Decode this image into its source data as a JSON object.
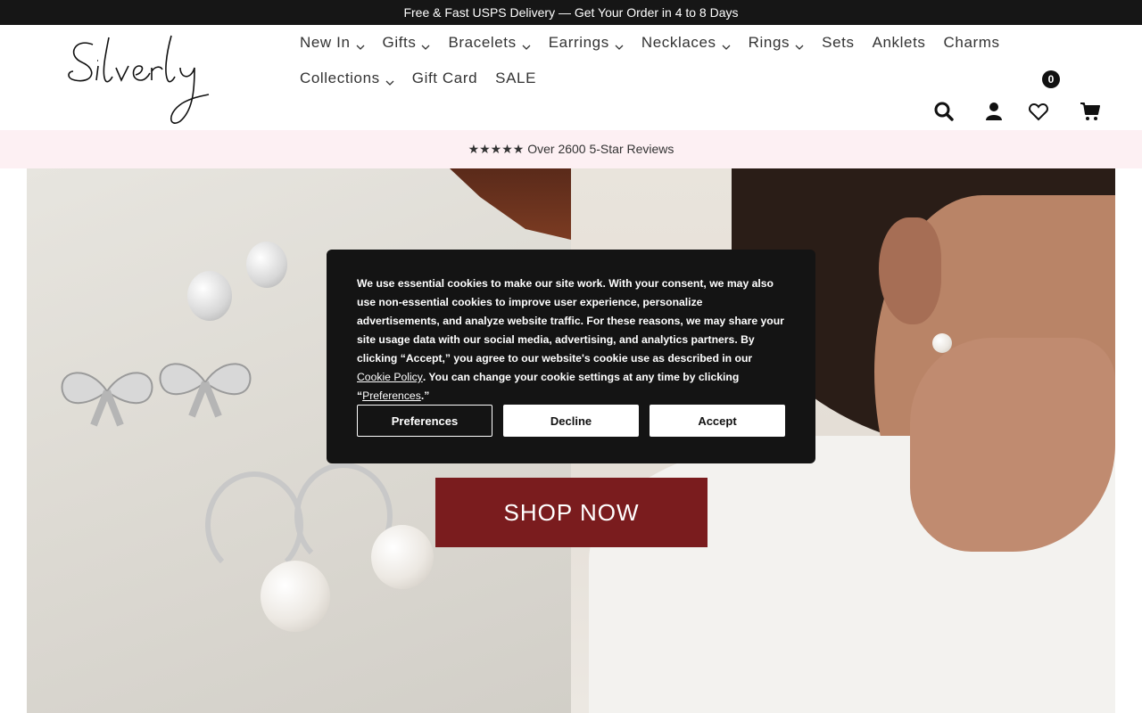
{
  "announcement": "Free & Fast USPS Delivery — Get Your Order in 4 to 8 Days",
  "logo": {
    "text": "Silverly"
  },
  "nav": {
    "row1": [
      {
        "label": "New In",
        "dropdown": true
      },
      {
        "label": "Gifts",
        "dropdown": true
      },
      {
        "label": "Bracelets",
        "dropdown": true
      },
      {
        "label": "Earrings",
        "dropdown": true
      },
      {
        "label": "Necklaces",
        "dropdown": true
      },
      {
        "label": "Rings",
        "dropdown": true
      },
      {
        "label": "Sets",
        "dropdown": false
      },
      {
        "label": "Anklets",
        "dropdown": false
      },
      {
        "label": "Charms",
        "dropdown": false
      }
    ],
    "row2": [
      {
        "label": "Collections",
        "dropdown": true
      },
      {
        "label": "Gift Card",
        "dropdown": false
      },
      {
        "label": "SALE",
        "dropdown": false
      }
    ]
  },
  "header_icons": {
    "search": "search-icon",
    "account": "user-icon",
    "wishlist": "heart-icon",
    "wishlist_count": "0",
    "cart": "cart-icon"
  },
  "reviews_bar": "★★★★★ Over 2600 5-Star Reviews",
  "hero": {
    "cta": "SHOP NOW",
    "cta_color": "#7a1c1e"
  },
  "cookie_banner": {
    "text_before_policy": "We use essential cookies to make our site work. With your consent, we may also use non-essential cookies to improve user experience, personalize advertisements, and analyze website traffic. For these reasons, we may share your site usage data with our social media, advertising, and analytics partners. By clicking “Accept,” you agree to our website's cookie use as described in our ",
    "policy_link": "Cookie Policy",
    "text_middle": ". You can change your cookie settings at any time by clicking “",
    "preferences_link": "Preferences",
    "text_end": ".”",
    "buttons": {
      "preferences": "Preferences",
      "decline": "Decline",
      "accept": "Accept"
    }
  },
  "colors": {
    "announcement_bg": "#161616",
    "reviews_bg": "#fdf0f3",
    "cookie_bg": "#141414"
  }
}
